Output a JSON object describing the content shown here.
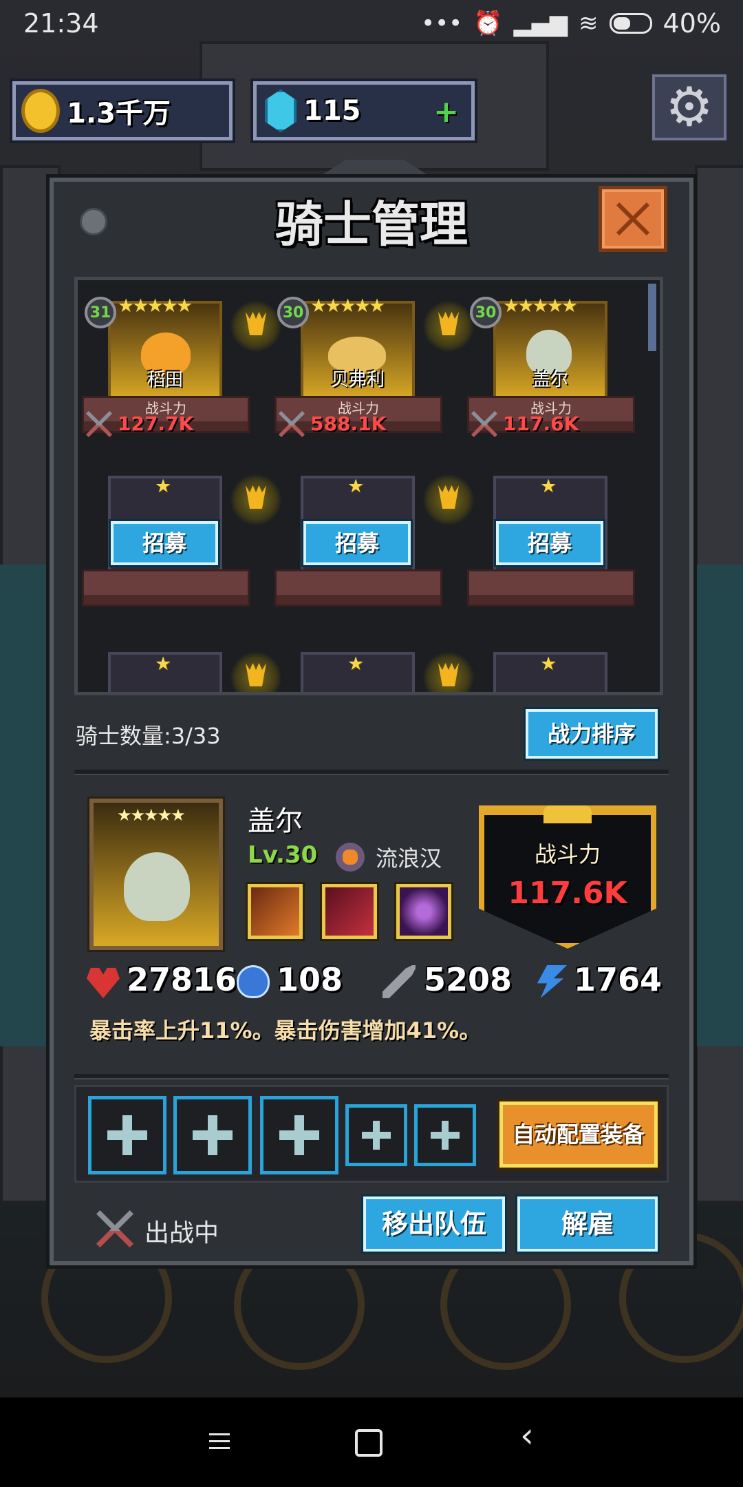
{
  "status_bar": {
    "time": "21:34",
    "battery": "40%"
  },
  "currency": {
    "gold": "1.3千万",
    "gems": "115"
  },
  "panel": {
    "title": "骑士管理"
  },
  "knights": [
    {
      "level": "31",
      "stars": "★★★★★",
      "name": "稻田",
      "power_label": "战斗力",
      "power": "127.7K"
    },
    {
      "level": "30",
      "stars": "★★★★★",
      "name": "贝弗利",
      "power_label": "战斗力",
      "power": "588.1K"
    },
    {
      "level": "30",
      "stars": "★★★★★",
      "name": "盖尔",
      "power_label": "战斗力",
      "power": "117.6K"
    }
  ],
  "empty_slots": {
    "stars": "★",
    "recruit_label": "招募"
  },
  "roster": {
    "count_text": "骑士数量:3/33",
    "sort_label": "战力排序"
  },
  "detail": {
    "stars": "★★★★★",
    "name": "盖尔",
    "level": "Lv.30",
    "class": "流浪汉",
    "power_label": "战斗力",
    "power": "117.6K",
    "stats": {
      "hp": "27816",
      "mp": "108",
      "attack": "5208",
      "speed": "1764"
    },
    "effect": "暴击率上升11%。暴击伤害增加41%。"
  },
  "equipment": {
    "auto_label": "自动配置装备"
  },
  "footer": {
    "status": "出战中",
    "remove_label": "移出队伍",
    "dismiss_label": "解雇"
  },
  "colors": {
    "accent_blue": "#2ea7e0",
    "power_red": "#ff4a4a",
    "gold": "#f2c12c"
  }
}
